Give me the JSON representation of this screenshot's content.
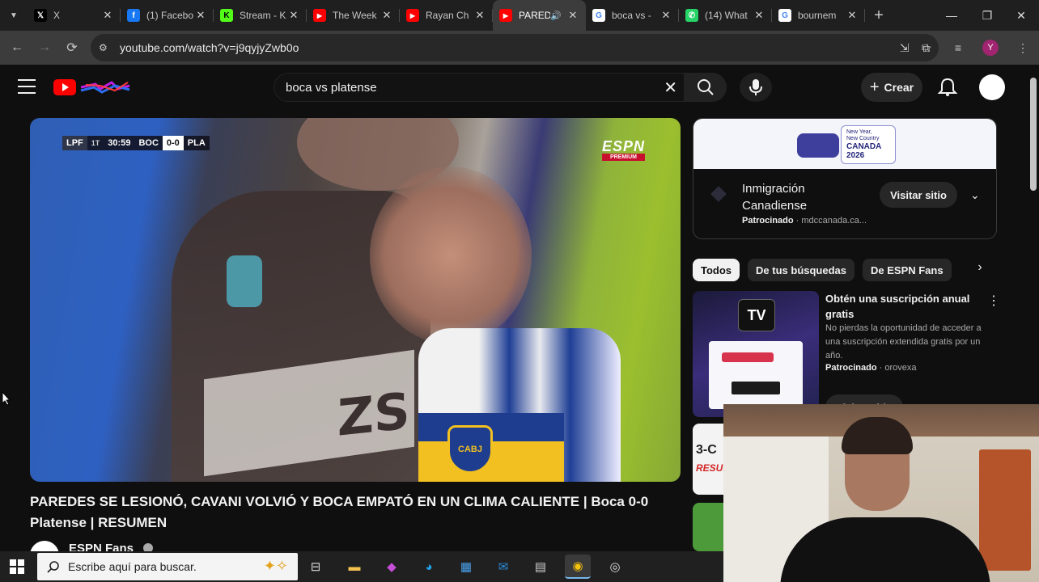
{
  "browser": {
    "tabs": [
      {
        "title": "X",
        "favicon": "x-logo-icon",
        "color": "#000000"
      },
      {
        "title": "(1) Facebo",
        "favicon": "facebook-icon",
        "color": "#1877f2"
      },
      {
        "title": "Stream - K",
        "favicon": "kick-icon",
        "color": "#53fc18"
      },
      {
        "title": "The Week",
        "favicon": "youtube-icon",
        "color": "#ff0000"
      },
      {
        "title": "Rayan Ch",
        "favicon": "youtube-icon",
        "color": "#ff0000"
      },
      {
        "title": "PARED",
        "favicon": "youtube-icon",
        "color": "#ff0000",
        "active": true
      },
      {
        "title": "boca vs -",
        "favicon": "google-icon",
        "color": "#ffffff"
      },
      {
        "title": "(14) What",
        "favicon": "whatsapp-icon",
        "color": "#25d366"
      },
      {
        "title": "bournem",
        "favicon": "google-icon",
        "color": "#ffffff"
      }
    ],
    "url": "youtube.com/watch?v=j9qyjyZwb0o",
    "profile_initial": "Y"
  },
  "youtube": {
    "search": {
      "value": "boca vs platense"
    },
    "create_label": "Crear",
    "video": {
      "scorebug": {
        "league": "LPF",
        "half": "1T",
        "clock": "30:59",
        "home": "BOC",
        "score": "0-0",
        "away": "PLA"
      },
      "broadcaster": "ESPN",
      "broadcaster_sub": "PREMIUM",
      "title": "PAREDES SE LESIONÓ, CAVANI VOLVIÓ Y BOCA EMPATÓ EN UN CLIMA CALIENTE | Boca 0-0 Platense | RESUMEN",
      "channel": "ESPN Fans",
      "crest_text": "CABJ",
      "shirt_text": "ZS"
    },
    "ad": {
      "banner_line1": "New Year,",
      "banner_line2": "New Country",
      "banner_line3": "CANADA",
      "banner_line4": "2026",
      "title": "Inmigración Canadiense",
      "sponsored": "Patrocinado",
      "domain": "mdccanada.ca...",
      "visit_label": "Visitar sitio"
    },
    "chips": [
      "Todos",
      "De tus búsquedas",
      "De ESPN Fans"
    ],
    "recommendation": {
      "title": "Obtén una suscripción anual gratis",
      "description": "No pierdas la oportunidad de acceder a una suscripción extendida gratis por un año.",
      "sponsored": "Patrocinado",
      "advertiser": "orovexa",
      "visit_label": "Visitar sitio",
      "thumb_logo": "TV"
    },
    "rec2": {
      "line1": "3-C",
      "line2": "RESUM"
    }
  },
  "taskbar": {
    "search_placeholder": "Escribe aquí para buscar.",
    "apps": [
      "task-view",
      "file-explorer",
      "copilot",
      "edge",
      "store",
      "outlook",
      "photos",
      "chrome",
      "obs"
    ]
  }
}
